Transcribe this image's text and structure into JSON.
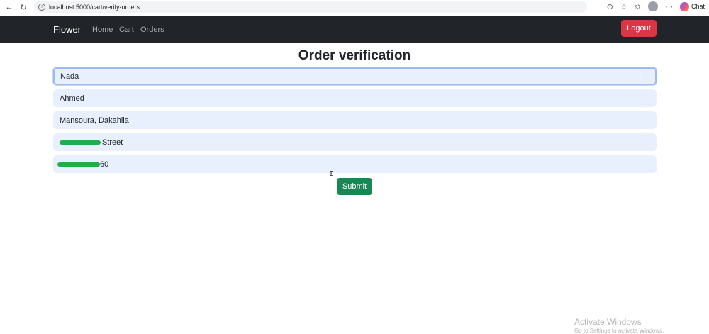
{
  "browser": {
    "url": "localhost:5000/cart/verify-orders",
    "chat_label": "Chat"
  },
  "navbar": {
    "brand": "Flower",
    "links": [
      "Home",
      "Cart",
      "Orders"
    ],
    "logout_label": "Logout"
  },
  "page": {
    "title": "Order verification"
  },
  "form": {
    "first_name": "Nada",
    "last_name": "Ahmed",
    "city": "Mansoura, Dakahlia",
    "street_visible": "Street",
    "phone_visible": "60",
    "submit_label": "Submit"
  },
  "overlay": {
    "watermark_title": "Activate Windows",
    "watermark_sub": "Go to Settings to activate Windows."
  },
  "colors": {
    "navbar_bg": "#212529",
    "logout_bg": "#dc3545",
    "submit_bg": "#198754",
    "field_bg": "#e8f0fe",
    "redaction": "#1fae4b"
  }
}
